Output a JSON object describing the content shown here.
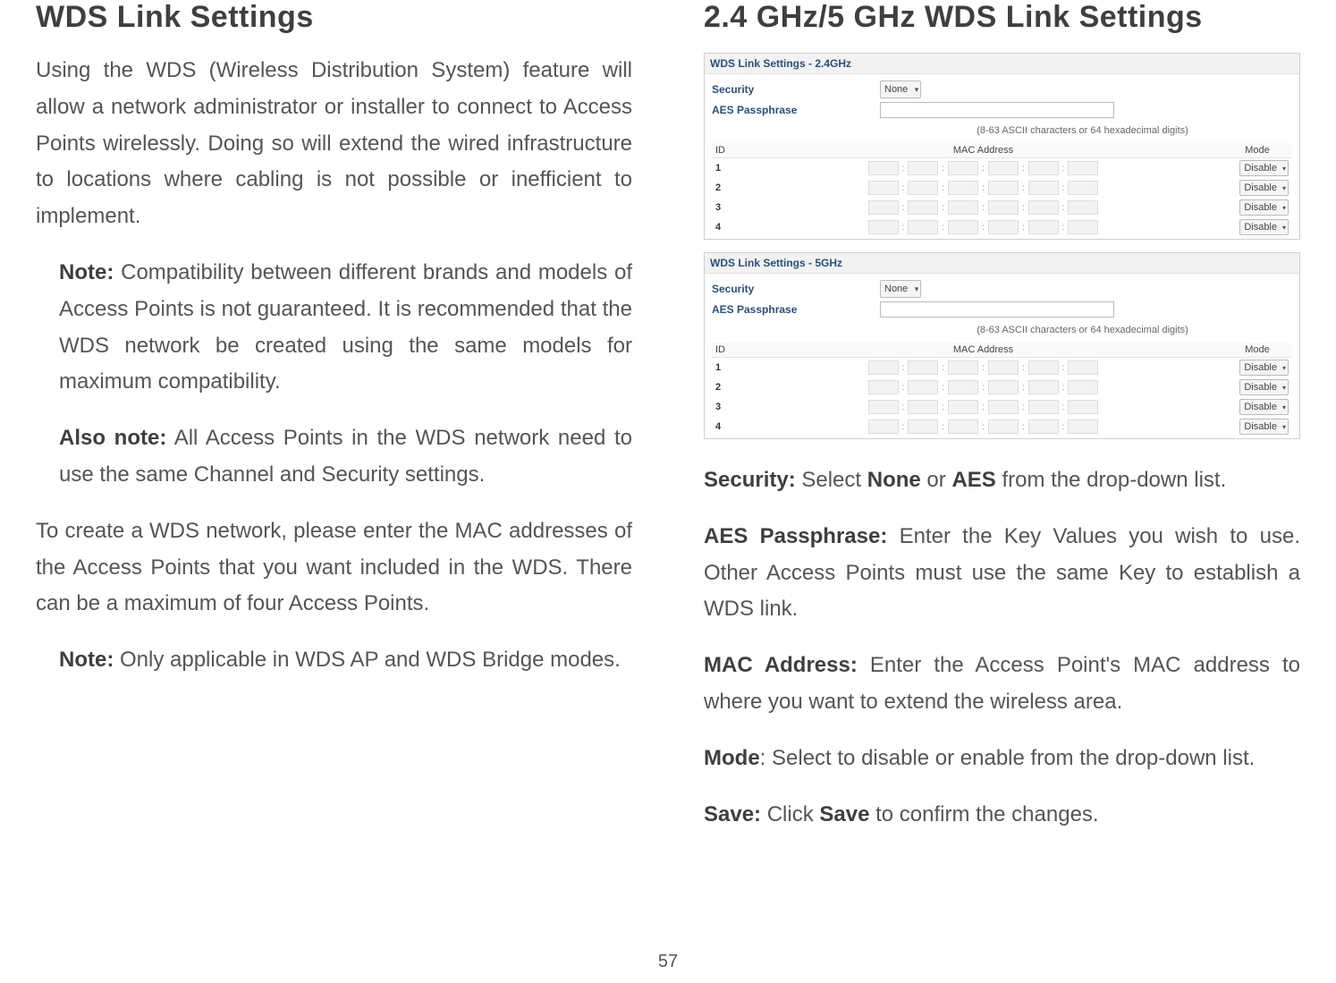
{
  "left": {
    "heading": "WDS Link Settings",
    "p1": "Using the WDS (Wireless Distribution System) feature will allow a network administrator or installer to connect to Access Points wirelessly. Doing so will extend the wired infrastructure to locations where cabling is not possible or inefficient to implement.",
    "note1_label": "Note:",
    "note1_text": " Compatibility between different brands and models of Access Points is not guaranteed. It is recommended that the WDS network be created using the same models for maximum compatibility.",
    "note2_label": "Also note:",
    "note2_text": " All Access Points in the WDS network need to use the same Channel and Security settings.",
    "p2": "To create a WDS network, please enter the MAC addresses of the Access Points that you want included in the WDS. There can be a maximum of four Access Points.",
    "note3_label": "Note:",
    "note3_text": " Only applicable in WDS AP and WDS Bridge modes."
  },
  "right": {
    "heading": "2.4 GHz/5 GHz WDS Link Settings",
    "panels": [
      {
        "title": "WDS Link Settings - 2.4GHz",
        "security_label": "Security",
        "security_value": "None",
        "pass_label": "AES Passphrase",
        "hint": "(8-63 ASCII characters or 64 hexadecimal digits)",
        "cols": {
          "id": "ID",
          "mac": "MAC Address",
          "mode": "Mode"
        },
        "rows": [
          {
            "id": "1",
            "mode": "Disable"
          },
          {
            "id": "2",
            "mode": "Disable"
          },
          {
            "id": "3",
            "mode": "Disable"
          },
          {
            "id": "4",
            "mode": "Disable"
          }
        ]
      },
      {
        "title": "WDS Link Settings - 5GHz",
        "security_label": "Security",
        "security_value": "None",
        "pass_label": "AES Passphrase",
        "hint": "(8-63 ASCII characters or 64 hexadecimal digits)",
        "cols": {
          "id": "ID",
          "mac": "MAC Address",
          "mode": "Mode"
        },
        "rows": [
          {
            "id": "1",
            "mode": "Disable"
          },
          {
            "id": "2",
            "mode": "Disable"
          },
          {
            "id": "3",
            "mode": "Disable"
          },
          {
            "id": "4",
            "mode": "Disable"
          }
        ]
      }
    ],
    "defs": {
      "security_label": "Security:",
      "security_text": " Select ",
      "security_opt1": "None",
      "security_mid": " or ",
      "security_opt2": "AES",
      "security_tail": " from the drop-down list.",
      "aes_label": "AES Passphrase:",
      "aes_text": " Enter the Key Values you wish to use. Other Access Points must use the same Key to establish a WDS link.",
      "mac_label": "MAC Address:",
      "mac_text": " Enter the Access Point's MAC address to where you want to extend the wireless area.",
      "mode_label": "Mode",
      "mode_text": ": Select to disable or enable from the drop-down list.",
      "save_label": "Save:",
      "save_text1": " Click ",
      "save_bold": "Save",
      "save_text2": " to confirm the changes."
    }
  },
  "page_number": "57"
}
